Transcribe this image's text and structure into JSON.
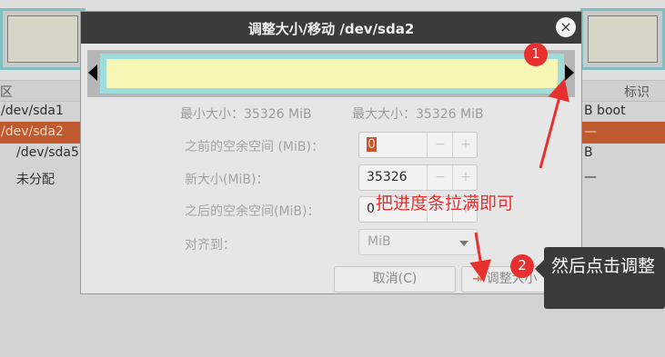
{
  "background": {
    "columns": {
      "partition": "区",
      "flags": "标识"
    },
    "rows": [
      {
        "name": "/dev/sda1",
        "flags": "B boot",
        "selected": false
      },
      {
        "name": "/dev/sda2",
        "flags": "—",
        "selected": true
      },
      {
        "name": "/dev/sda5",
        "flags": "B",
        "selected": false
      },
      {
        "name": "未分配",
        "flags": "—",
        "selected": false
      }
    ]
  },
  "dialog": {
    "title": "调整大小/移动 /dev/sda2",
    "close_icon": "close-icon",
    "min_size": "最小大小：35326 MiB",
    "max_size": "最大大小：35326 MiB",
    "fields": {
      "free_before": {
        "label": "之前的空余空间 (MiB)：",
        "value": "0"
      },
      "new_size": {
        "label": "新大小(MiB)：",
        "value": "35326"
      },
      "free_after": {
        "label": "之后的空余空间(MiB)：",
        "value": "0"
      },
      "align_to": {
        "label": "对齐到：",
        "value": "MiB"
      }
    },
    "spin_minus": "−",
    "spin_plus": "+",
    "cancel_label": "取消(C)",
    "resize_label": "调整大小",
    "resize_icon": "resize-icon"
  },
  "annotations": {
    "badge1": "1",
    "badge2": "2",
    "hint": "把进度条拉满即可",
    "tooltip": "然后点击调整"
  },
  "colors": {
    "annotation_red": "#e8312f",
    "selection": "#c05a2e",
    "bar_frame": "#9fdcdc",
    "bar_fill": "#f8f6b4",
    "titlebar": "#3b3b3b"
  }
}
